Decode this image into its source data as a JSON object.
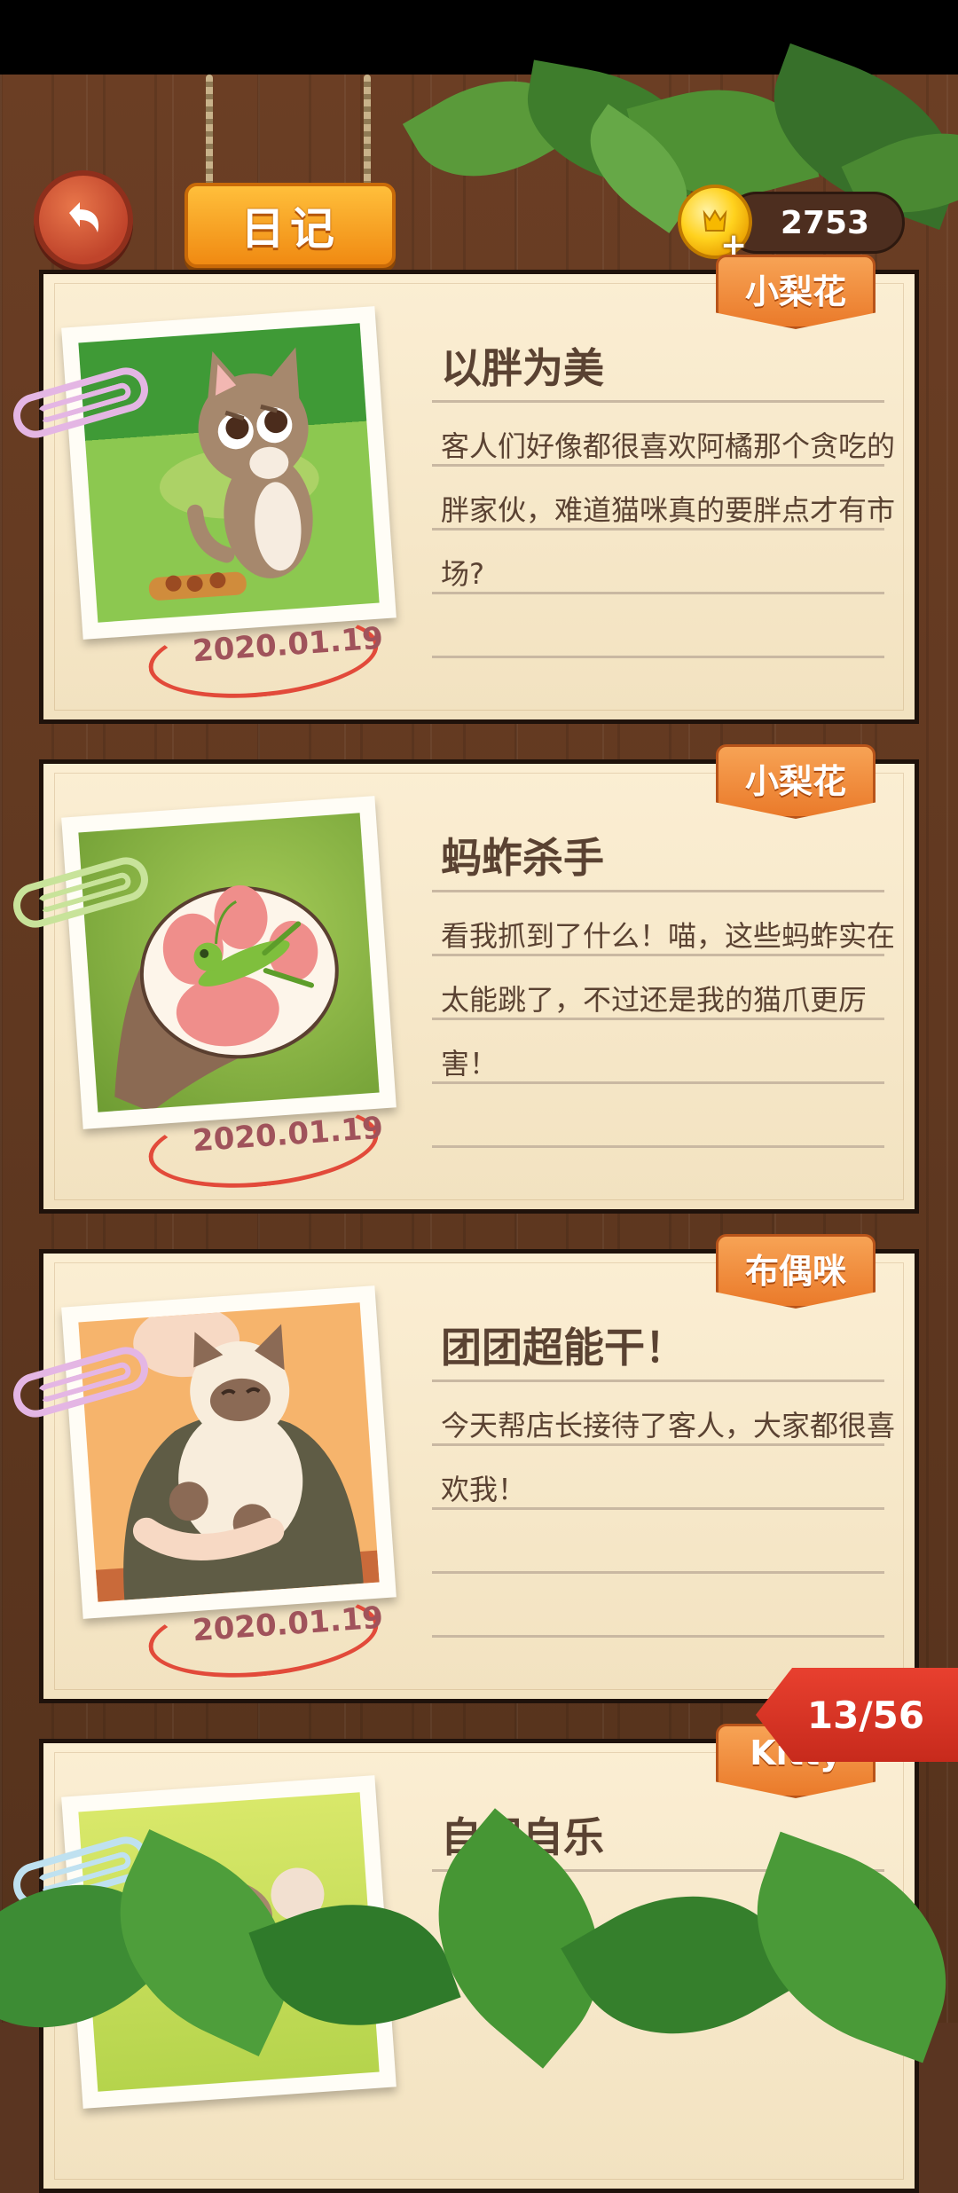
{
  "header": {
    "back_label": "返回",
    "title": "日记",
    "coins": "2753",
    "coin_plus": "+"
  },
  "entries": [
    {
      "cat_name": "小梨花",
      "date": "2020.01.19",
      "title": "以胖为美",
      "body": "客人们好像都很喜欢阿橘那个贪吃的胖家伙，难道猫咪真的要胖点才有市场?"
    },
    {
      "cat_name": "小梨花",
      "date": "2020.01.19",
      "title": "蚂蚱杀手",
      "body": "看我抓到了什么！喵，这些蚂蚱实在太能跳了，不过还是我的猫爪更厉害！"
    },
    {
      "cat_name": "布偶咪",
      "date": "2020.01.19",
      "title": "团团超能干！",
      "body": "今天帮店长接待了客人，大家都很喜欢我！"
    },
    {
      "cat_name": "Kitty",
      "date": "",
      "title": "自娱自乐",
      "body": ""
    }
  ],
  "pagination": {
    "label": "13/56"
  },
  "icons": {
    "back": "back-arrow-icon",
    "coin": "coin-icon",
    "clip": "paperclip-icon"
  },
  "colors": {
    "wood": "#5a3521",
    "paper": "#f7e8c9",
    "tag": "#ee8537",
    "title_plank": "#f6a11f",
    "ribbon": "#d9352a",
    "date_circle": "#e24a3a",
    "leaf": "#3d8c34"
  }
}
